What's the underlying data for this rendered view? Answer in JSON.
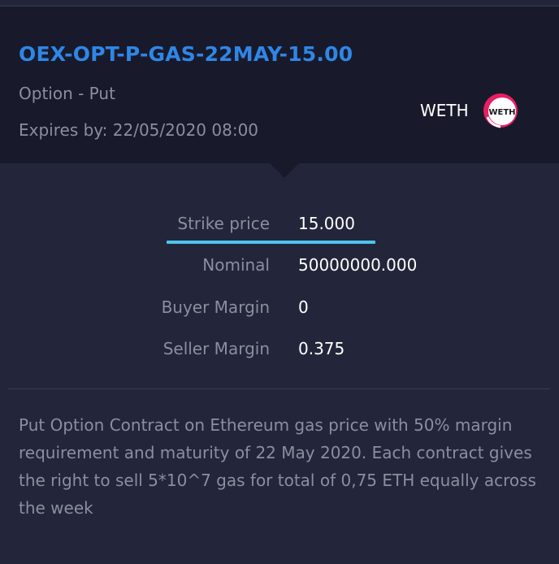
{
  "header": {
    "title": "OEX-OPT-P-GAS-22MAY-15.00",
    "type": "Option - Put",
    "expires": "Expires by: 22/05/2020 08:00",
    "collateral": "WETH",
    "logo_text": "WETH"
  },
  "details": {
    "strike_label": "Strike price",
    "strike_value": "15.000",
    "nominal_label": "Nominal",
    "nominal_value": "50000000.000",
    "buyer_margin_label": "Buyer Margin",
    "buyer_margin_value": "0",
    "seller_margin_label": "Seller Margin",
    "seller_margin_value": "0.375"
  },
  "description": "Put Option Contract on Ethereum gas price with 50% margin requirement and maturity of 22 May 2020. Each contract gives the right to sell 5*10^7 gas for total of 0,75 ETH equally across the week",
  "colors": {
    "accent_blue": "#2f86e6",
    "underline_cyan": "#4ec4ee",
    "logo_pink": "#e91e63"
  }
}
